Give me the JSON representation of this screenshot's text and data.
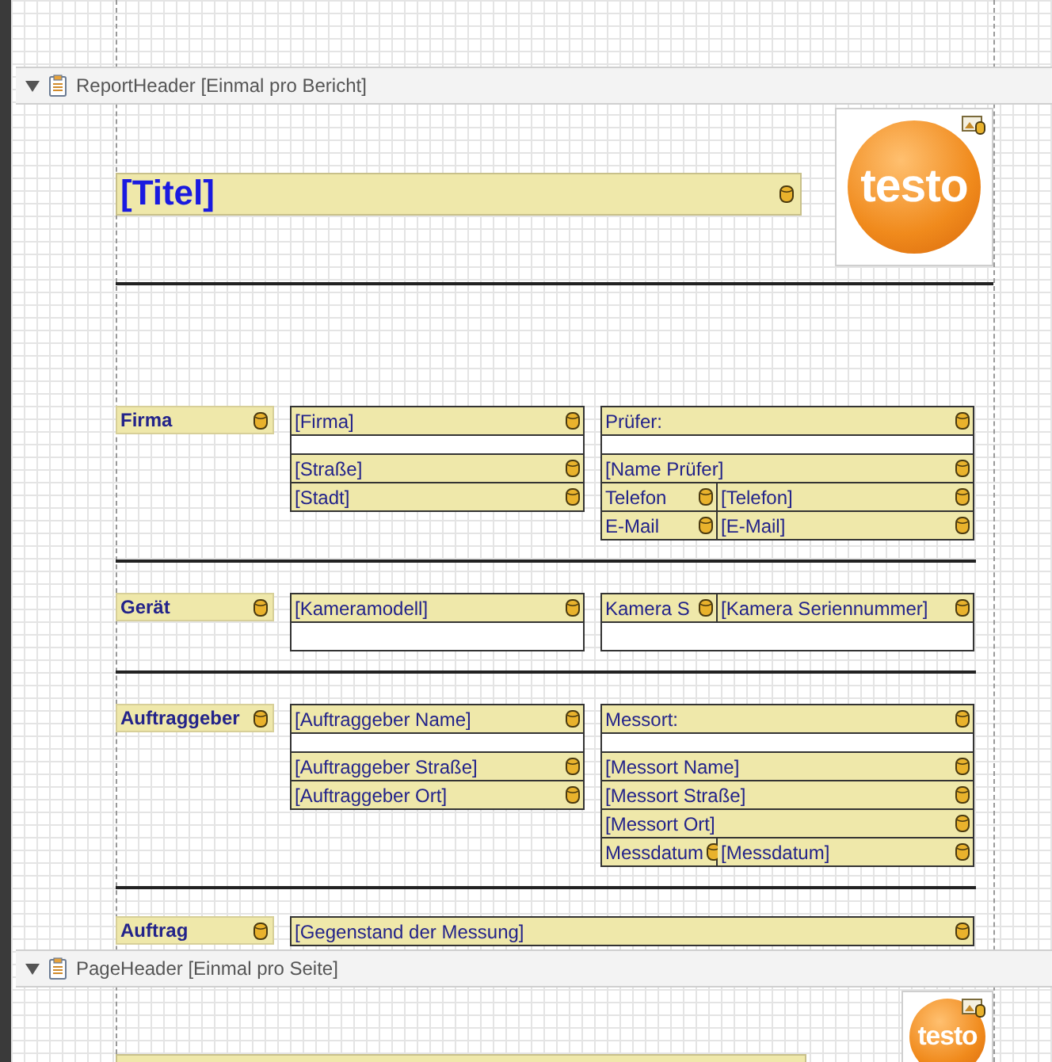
{
  "bands": [
    {
      "kind": "report",
      "title": "ReportHeader [Einmal pro Bericht]",
      "title_field": "[Titel]",
      "logo": "testo",
      "sections": [
        {
          "label": "Firma",
          "left": [
            {
              "kind": "field",
              "cells": [
                "[Firma]"
              ]
            },
            {
              "kind": "spacer"
            },
            {
              "kind": "field",
              "cells": [
                "[Straße]"
              ]
            },
            {
              "kind": "field",
              "cells": [
                "[Stadt]"
              ]
            }
          ],
          "right": [
            {
              "kind": "field",
              "cells": [
                "Prüfer:"
              ]
            },
            {
              "kind": "spacer"
            },
            {
              "kind": "field",
              "cells": [
                "[Name Prüfer]"
              ]
            },
            {
              "kind": "field",
              "cells": [
                "Telefon",
                "[Telefon]"
              ]
            },
            {
              "kind": "field",
              "cells": [
                "E-Mail",
                "[E-Mail]"
              ]
            }
          ]
        },
        {
          "label": "Gerät",
          "left": [
            {
              "kind": "field",
              "cells": [
                "[Kameramodell]"
              ]
            },
            {
              "kind": "spacer"
            }
          ],
          "right": [
            {
              "kind": "field",
              "cells": [
                "Kamera S",
                "[Kamera Seriennummer]"
              ]
            },
            {
              "kind": "spacer"
            }
          ]
        },
        {
          "label": "Auftraggeber",
          "left": [
            {
              "kind": "field",
              "cells": [
                "[Auftraggeber Name]"
              ]
            },
            {
              "kind": "spacer"
            },
            {
              "kind": "field",
              "cells": [
                "[Auftraggeber Straße]"
              ]
            },
            {
              "kind": "field",
              "cells": [
                "[Auftraggeber Ort]"
              ]
            }
          ],
          "right": [
            {
              "kind": "field",
              "cells": [
                "Messort:"
              ]
            },
            {
              "kind": "spacer"
            },
            {
              "kind": "field",
              "cells": [
                "[Messort Name]"
              ]
            },
            {
              "kind": "field",
              "cells": [
                "[Messort Straße]"
              ]
            },
            {
              "kind": "field",
              "cells": [
                "[Messort Ort]"
              ]
            },
            {
              "kind": "field",
              "cells": [
                "Messdatum",
                "[Messdatum]"
              ]
            }
          ]
        },
        {
          "label": "Auftrag",
          "left": [
            {
              "kind": "field",
              "cells": [
                "[Gegenstand der Messung]"
              ]
            }
          ]
        }
      ]
    },
    {
      "kind": "page",
      "title": "PageHeader [Einmal pro Seite]",
      "logo": "testo"
    }
  ]
}
